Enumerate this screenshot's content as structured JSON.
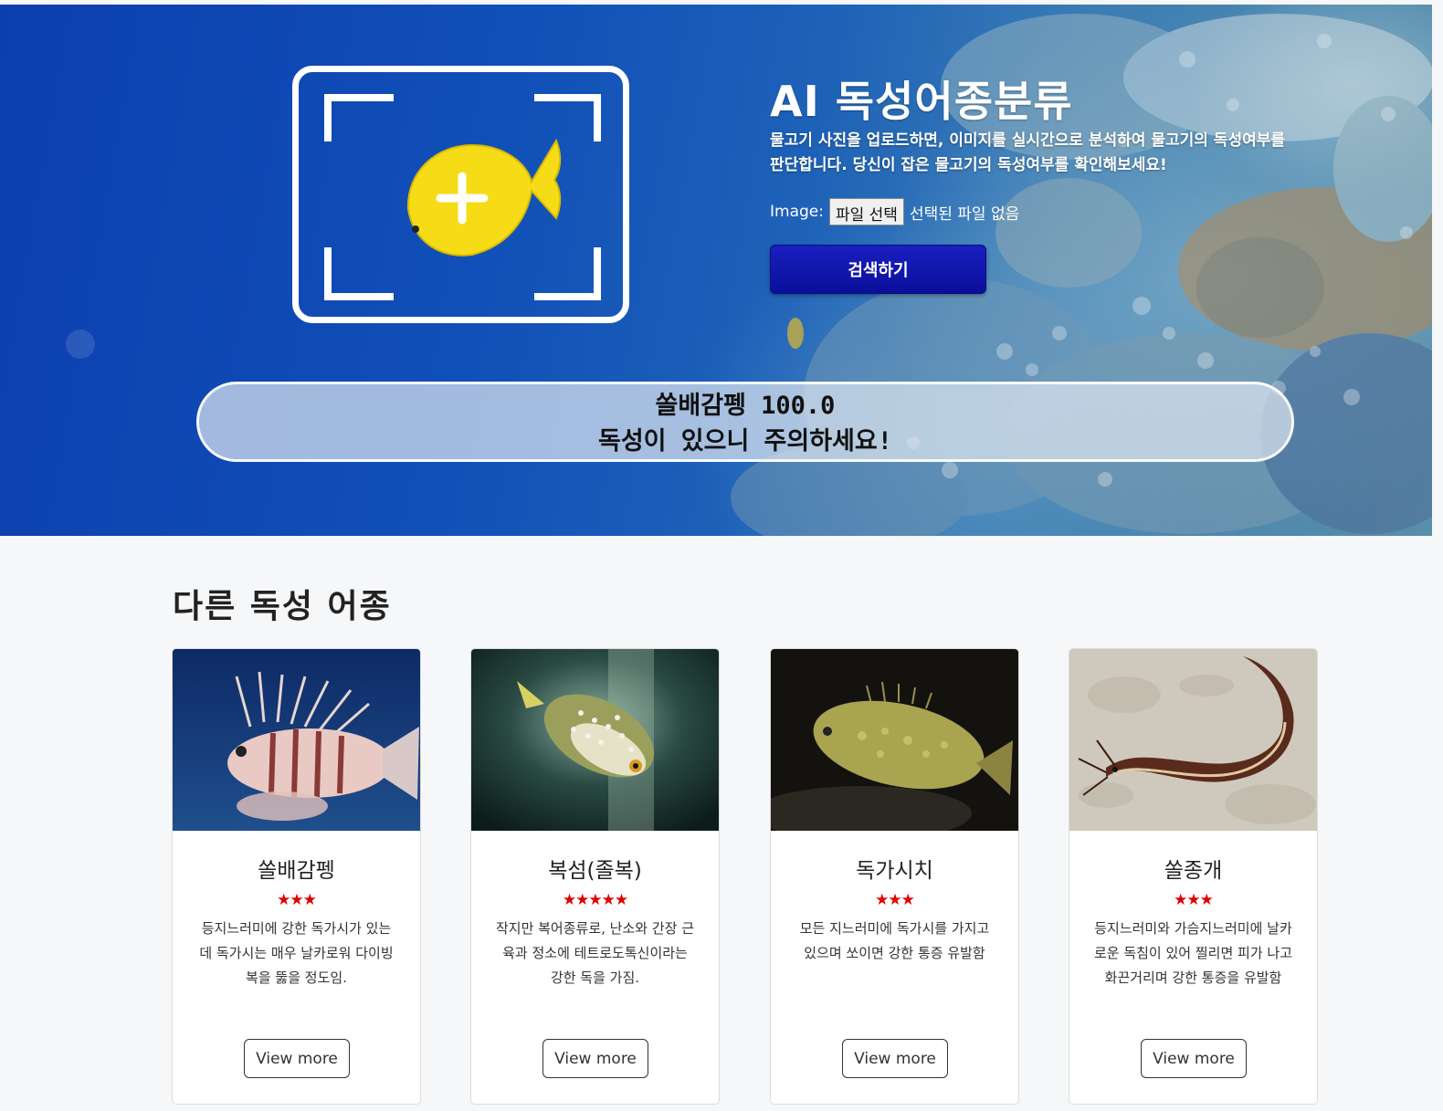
{
  "hero": {
    "title": "AI 독성어종분류",
    "description": "물고기 사진을 업로드하면, 이미지를 실시간으로 분석하여 물고기의 독성여부를 판단합니다. 당신이 잡은 물고기의 독성여부를 확인해보세요!",
    "file_label": "Image:",
    "file_button": "파일 선택",
    "file_status": "선택된 파일 없음",
    "search_button": "검색하기",
    "result_line1": "쏠배감펭 100.0",
    "result_line2": "독성이 있으니 주의하세요!"
  },
  "section": {
    "title": "다른 독성 어종"
  },
  "cards": [
    {
      "name": "쏠배감펭",
      "stars": "★★★",
      "rating": 3,
      "description": "등지느러미에 강한 독가시가 있는데 독가시는 매우 날카로워 다이빙복을 뚫을 정도임.",
      "button": "View more",
      "image_icon": "lionfish-photo"
    },
    {
      "name": "복섬(졸복)",
      "stars": "★★★★★",
      "rating": 5,
      "description": "작지만 복어종류로, 난소와 간장 근육과 정소에 테트로도톡신이라는 강한 독을 가짐.",
      "button": "View more",
      "image_icon": "pufferfish-photo"
    },
    {
      "name": "독가시치",
      "stars": "★★★",
      "rating": 3,
      "description": "모든 지느러미에 독가시를 가지고 있으며 쏘이면 강한 통증 유발함",
      "button": "View more",
      "image_icon": "rabbitfish-photo"
    },
    {
      "name": "쏠종개",
      "stars": "★★★",
      "rating": 3,
      "description": "등지느러미와 가슴지느러미에 날카로운 독침이 있어 찔리면 피가 나고 화끈거리며 강한 통증을 유발함",
      "button": "View more",
      "image_icon": "catfish-eel-photo"
    }
  ],
  "colors": {
    "accent_button": "#0a0f9a",
    "star": "#e00000",
    "hero_ocean": "#0c3fae"
  }
}
